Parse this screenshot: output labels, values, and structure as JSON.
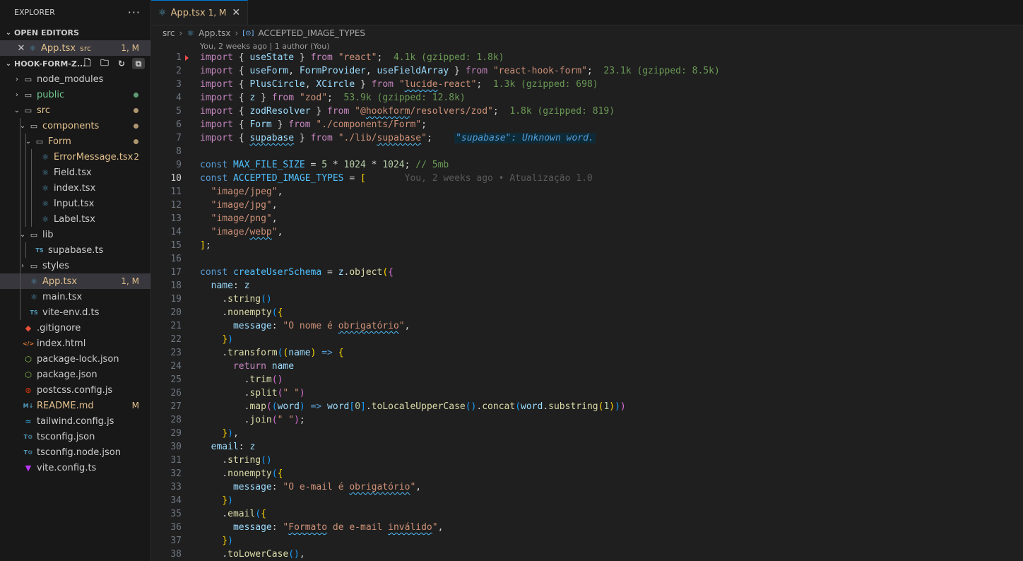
{
  "explorer": {
    "title": "EXPLORER",
    "open_editors_title": "OPEN EDITORS",
    "open_editor": {
      "label": "App.tsx",
      "sub": "src",
      "badge": "1, M"
    },
    "project_title": "HOOK-FORM-Z...",
    "tree": [
      {
        "label": "node_modules",
        "depth": 1,
        "kind": "folder",
        "open": false
      },
      {
        "label": "public",
        "depth": 1,
        "kind": "folder",
        "open": false,
        "color": "#73c991",
        "dot": "#73c991"
      },
      {
        "label": "src",
        "depth": 1,
        "kind": "folder",
        "open": true,
        "color": "#e2c08d",
        "dot": "#e2c08d"
      },
      {
        "label": "components",
        "depth": 2,
        "kind": "folder",
        "open": true,
        "color": "#e2c08d",
        "dot": "#e2c08d"
      },
      {
        "label": "Form",
        "depth": 3,
        "kind": "folder",
        "open": true,
        "color": "#e2c08d",
        "dot": "#e2c08d"
      },
      {
        "label": "ErrorMessage.tsx",
        "depth": 4,
        "kind": "react",
        "color": "#e2c08d",
        "badge": "2"
      },
      {
        "label": "Field.tsx",
        "depth": 4,
        "kind": "react"
      },
      {
        "label": "index.tsx",
        "depth": 4,
        "kind": "react"
      },
      {
        "label": "Input.tsx",
        "depth": 4,
        "kind": "react"
      },
      {
        "label": "Label.tsx",
        "depth": 4,
        "kind": "react"
      },
      {
        "label": "lib",
        "depth": 2,
        "kind": "folder",
        "open": true
      },
      {
        "label": "supabase.ts",
        "depth": 3,
        "kind": "ts"
      },
      {
        "label": "styles",
        "depth": 2,
        "kind": "folder",
        "open": false
      },
      {
        "label": "App.tsx",
        "depth": 2,
        "kind": "react",
        "color": "#e2c08d",
        "badge": "1, M",
        "selected": true
      },
      {
        "label": "main.tsx",
        "depth": 2,
        "kind": "react"
      },
      {
        "label": "vite-env.d.ts",
        "depth": 2,
        "kind": "ts"
      },
      {
        "label": ".gitignore",
        "depth": 1,
        "kind": "git"
      },
      {
        "label": "index.html",
        "depth": 1,
        "kind": "html"
      },
      {
        "label": "package-lock.json",
        "depth": 1,
        "kind": "node"
      },
      {
        "label": "package.json",
        "depth": 1,
        "kind": "node"
      },
      {
        "label": "postcss.config.js",
        "depth": 1,
        "kind": "postcss"
      },
      {
        "label": "README.md",
        "depth": 1,
        "kind": "md",
        "color": "#e2c08d",
        "badge": "M"
      },
      {
        "label": "tailwind.config.js",
        "depth": 1,
        "kind": "tailwind"
      },
      {
        "label": "tsconfig.json",
        "depth": 1,
        "kind": "tsconfig"
      },
      {
        "label": "tsconfig.node.json",
        "depth": 1,
        "kind": "tsconfig"
      },
      {
        "label": "vite.config.ts",
        "depth": 1,
        "kind": "vite"
      }
    ]
  },
  "tab": {
    "label": "App.tsx",
    "status": "1, M"
  },
  "breadcrumb": {
    "folder": "src",
    "file": "App.tsx",
    "symbol": "ACCEPTED_IMAGE_TYPES"
  },
  "blame_header": "You, 2 weeks ago | 1 author (You)",
  "inline_blame": "You, 2 weeks ago • Atualização 1.0",
  "import_sizes": [
    "4.1k (gzipped: 1.8k)",
    "23.1k (gzipped: 8.5k)",
    "1.3k (gzipped: 698)",
    "53.9k (gzipped: 12.8k)",
    "1.8k (gzipped: 819)"
  ],
  "diagnostic": "\"supabase\": Unknown word.",
  "active_line": 10
}
